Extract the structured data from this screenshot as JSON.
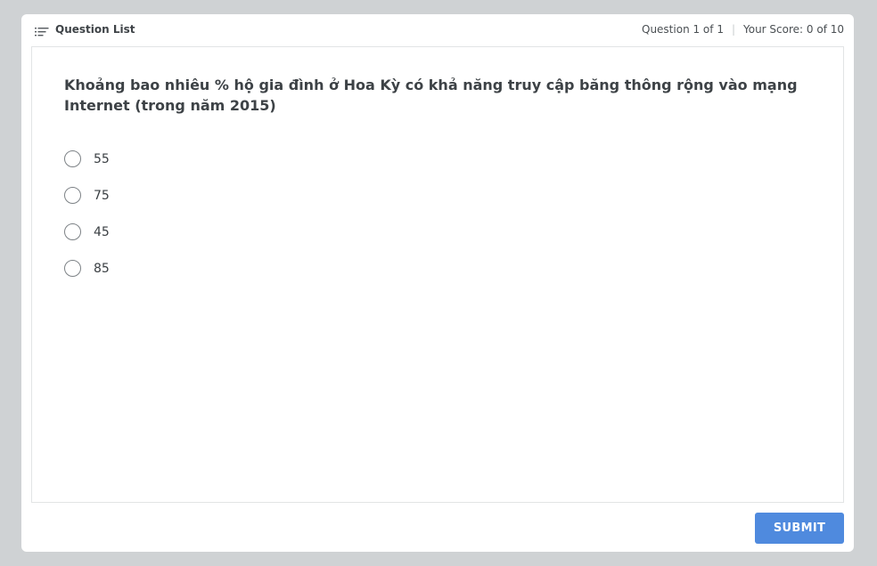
{
  "header": {
    "question_list_label": "Question List",
    "question_counter": "Question 1 of 1",
    "score": "Your Score: 0 of 10"
  },
  "question": {
    "text": "Khoảng bao nhiêu % hộ gia đình ở Hoa Kỳ có khả năng truy cập băng thông rộng vào mạng Internet (trong năm 2015)",
    "options": [
      {
        "label": "55"
      },
      {
        "label": "75"
      },
      {
        "label": "45"
      },
      {
        "label": "85"
      }
    ]
  },
  "footer": {
    "submit_label": "SUBMIT"
  },
  "colors": {
    "accent": "#4f8ade",
    "background": "#cfd2d4"
  },
  "icons": {
    "question_list": "list-icon"
  }
}
